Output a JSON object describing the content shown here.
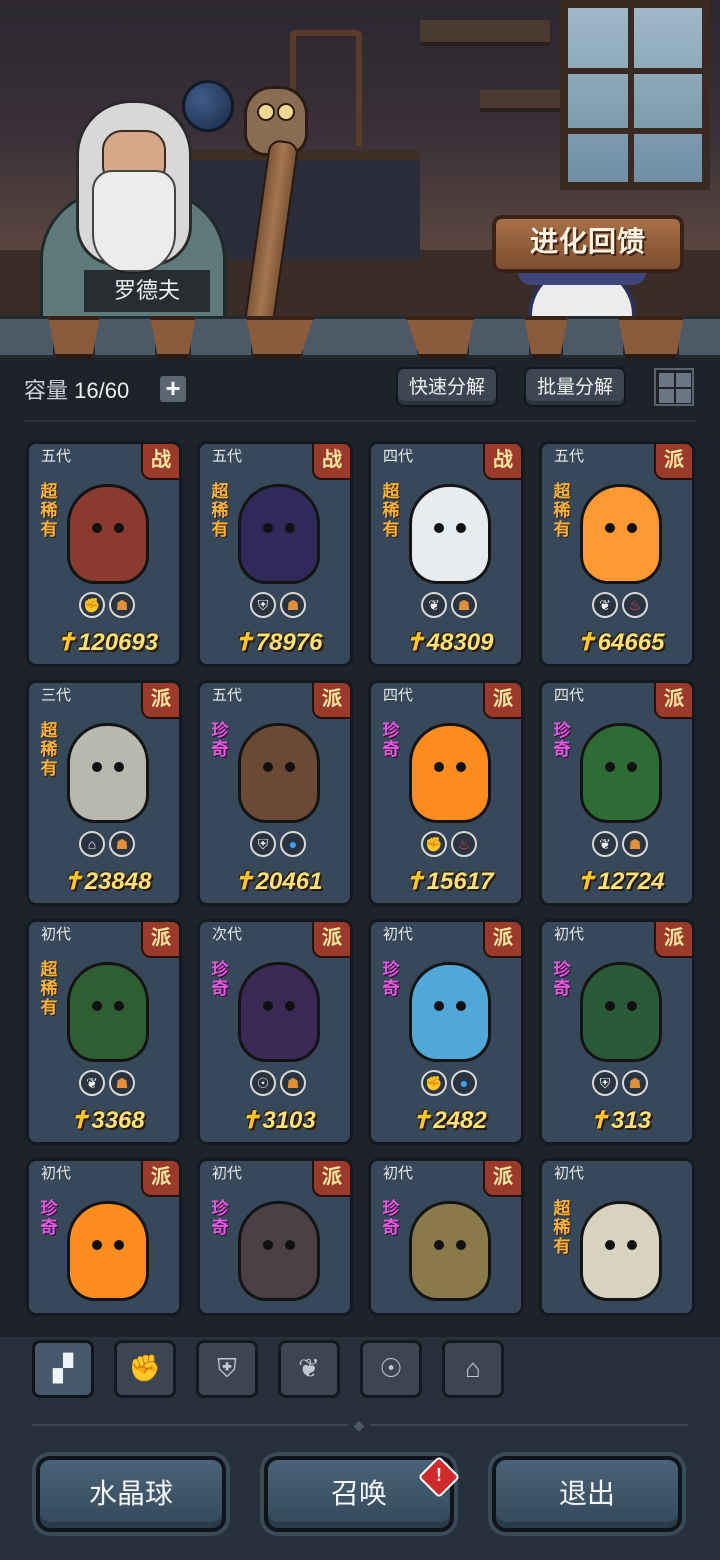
{
  "npc": {
    "name": "罗德夫"
  },
  "banner": {
    "label": "进化回馈"
  },
  "toolbar": {
    "capacity_label": "容量",
    "capacity_value": "16/60",
    "add_symbol": "+",
    "quick_dismantle": "快速分解",
    "batch_dismantle": "批量分解"
  },
  "cards": [
    {
      "gen": "五代",
      "tag": "战",
      "rarity": "超稀有",
      "icons": [
        "fist",
        "earth"
      ],
      "power": "120693",
      "color": "#8b3a2f"
    },
    {
      "gen": "五代",
      "tag": "战",
      "rarity": "超稀有",
      "icons": [
        "shield",
        "earth"
      ],
      "power": "78976",
      "color": "#2f2a5a"
    },
    {
      "gen": "四代",
      "tag": "战",
      "rarity": "超稀有",
      "icons": [
        "leaf",
        "earth"
      ],
      "power": "48309",
      "color": "#e8ecee"
    },
    {
      "gen": "五代",
      "tag": "派",
      "rarity": "超稀有",
      "icons": [
        "leaf",
        "fire"
      ],
      "power": "64665",
      "color": "#ff9a33"
    },
    {
      "gen": "三代",
      "tag": "派",
      "rarity": "超稀有",
      "icons": [
        "horn",
        "earth"
      ],
      "power": "23848",
      "color": "#b8b8ae"
    },
    {
      "gen": "五代",
      "tag": "派",
      "rarity": "珍奇",
      "icons": [
        "shield",
        "water"
      ],
      "power": "20461",
      "color": "#6b4a35"
    },
    {
      "gen": "四代",
      "tag": "派",
      "rarity": "珍奇",
      "icons": [
        "fist",
        "fire"
      ],
      "power": "15617",
      "color": "#ff8c1f"
    },
    {
      "gen": "四代",
      "tag": "派",
      "rarity": "珍奇",
      "icons": [
        "leaf",
        "earth"
      ],
      "power": "12724",
      "color": "#2f6b35"
    },
    {
      "gen": "初代",
      "tag": "派",
      "rarity": "超稀有",
      "icons": [
        "leaf",
        "earth"
      ],
      "power": "3368",
      "color": "#2f5e33"
    },
    {
      "gen": "次代",
      "tag": "派",
      "rarity": "珍奇",
      "icons": [
        "spirit",
        "earth"
      ],
      "power": "3103",
      "color": "#3b2a55"
    },
    {
      "gen": "初代",
      "tag": "派",
      "rarity": "珍奇",
      "icons": [
        "fist",
        "water"
      ],
      "power": "2482",
      "color": "#4fa8d8"
    },
    {
      "gen": "初代",
      "tag": "派",
      "rarity": "珍奇",
      "icons": [
        "shield",
        "earth"
      ],
      "power": "313",
      "color": "#2b5a38"
    },
    {
      "gen": "初代",
      "tag": "派",
      "rarity": "珍奇",
      "icons": [],
      "power": "",
      "color": "#ff8c1f"
    },
    {
      "gen": "初代",
      "tag": "派",
      "rarity": "珍奇",
      "icons": [],
      "power": "",
      "color": "#4a4046"
    },
    {
      "gen": "初代",
      "tag": "派",
      "rarity": "珍奇",
      "icons": [],
      "power": "",
      "color": "#8a7a4a"
    },
    {
      "gen": "初代",
      "tag": "",
      "rarity": "超稀有",
      "icons": [],
      "power": "",
      "color": "#d8d2c0"
    }
  ],
  "filters": [
    {
      "icon": "all-icon",
      "glyph": "▞",
      "active": true
    },
    {
      "icon": "fist-icon",
      "glyph": "✊",
      "active": false
    },
    {
      "icon": "shield-icon",
      "glyph": "⛨",
      "active": false
    },
    {
      "icon": "leaf-icon",
      "glyph": "❦",
      "active": false
    },
    {
      "icon": "spirit-icon",
      "glyph": "☉",
      "active": false
    },
    {
      "icon": "horn-icon",
      "glyph": "⌂",
      "active": false
    }
  ],
  "buttons": {
    "crystal_ball": "水晶球",
    "summon": "召唤",
    "exit": "退出",
    "summon_alert": "!"
  },
  "colors": {
    "super_rare": "#f6b340",
    "rare": "#e05cde",
    "power": "#ffe27a",
    "tag_bg": "#9a3a2a"
  }
}
